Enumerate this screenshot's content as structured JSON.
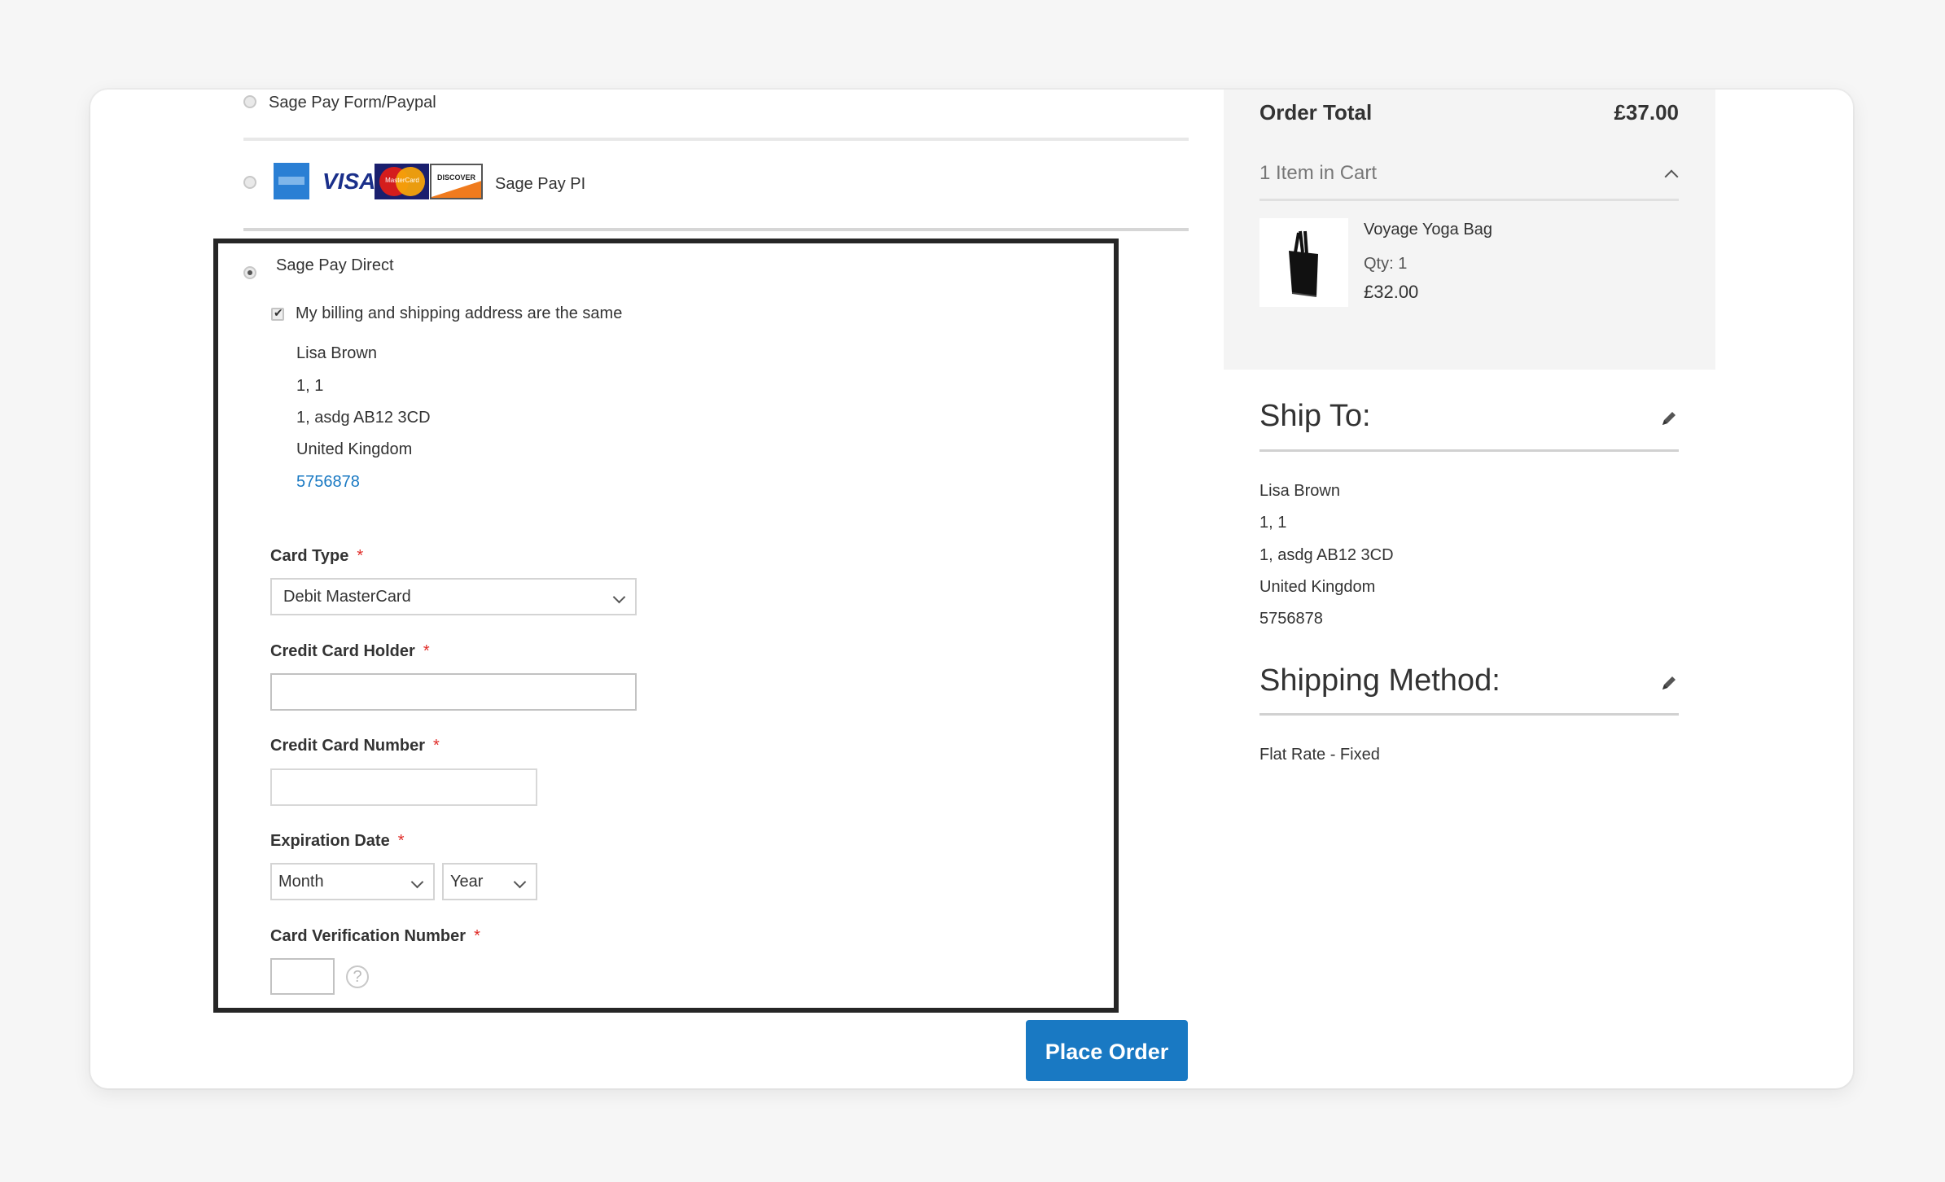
{
  "payment_methods": {
    "form_paypal": {
      "label": "Sage Pay Form/Paypal",
      "selected": false
    },
    "pi": {
      "label": "Sage Pay PI",
      "selected": false,
      "card_logos": [
        "amex-logo",
        "visa-logo",
        "mastercard-logo",
        "discover-logo"
      ],
      "visa_text": "VISA",
      "discover_text": "DISCOVER",
      "mastercard_text": "MasterCard"
    },
    "direct": {
      "label": "Sage Pay Direct",
      "selected": true,
      "same_address_label": "My billing and shipping address are the same",
      "same_address_checked": true,
      "billing_address": {
        "name": "Lisa Brown",
        "line1": "1, 1",
        "line2": "1, asdg AB12 3CD",
        "country": "United Kingdom",
        "phone": "5756878"
      },
      "fields": {
        "card_type": {
          "label": "Card Type",
          "required_mark": "*",
          "value": "Debit MasterCard"
        },
        "card_holder": {
          "label": "Credit Card Holder",
          "required_mark": "*",
          "value": ""
        },
        "card_number": {
          "label": "Credit Card Number",
          "required_mark": "*",
          "value": ""
        },
        "expiration": {
          "label": "Expiration Date",
          "required_mark": "*",
          "month_value": "Month",
          "year_value": "Year"
        },
        "cvn": {
          "label": "Card Verification Number",
          "required_mark": "*",
          "value": "",
          "help_icon": "?"
        }
      }
    }
  },
  "actions": {
    "place_order_label": "Place Order"
  },
  "summary": {
    "order_total_label": "Order Total",
    "order_total_value": "£37.00",
    "items_in_cart": "1 Item in Cart",
    "items": [
      {
        "name": "Voyage Yoga Bag",
        "qty": "Qty: 1",
        "price": "£32.00"
      }
    ]
  },
  "ship_to": {
    "heading": "Ship To:",
    "name": "Lisa Brown",
    "line1": "1, 1",
    "line2": "1, asdg AB12 3CD",
    "country": "United Kingdom",
    "phone": "5756878"
  },
  "shipping_method": {
    "heading": "Shipping Method:",
    "value": "Flat Rate - Fixed"
  },
  "colors": {
    "primary_button": "#1979c3",
    "link": "#1979c3",
    "required": "#e02b27",
    "highlight_border": "#262626",
    "summary_bg": "#f4f4f4"
  }
}
